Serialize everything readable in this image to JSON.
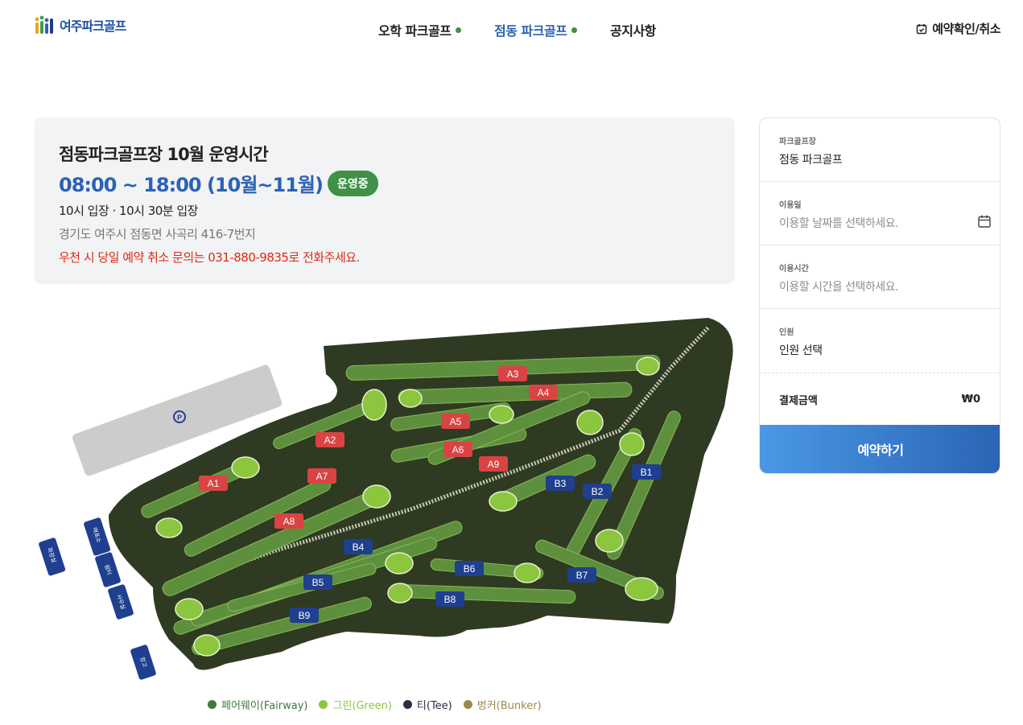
{
  "header": {
    "logo_text": "여주파크골프",
    "nav": [
      {
        "label": "오학 파크골프"
      },
      {
        "label": "점동 파크골프"
      },
      {
        "label": "공지사항"
      }
    ],
    "reserve_label": "예약확인/취소"
  },
  "info": {
    "title": "점동파크골프장 10월 운영시간",
    "hours": "08:00 ~ 18:00 (10월~11월)",
    "status_badge": "운영중",
    "entry": "10시 입장 · 10시 30분 입장",
    "address": "경기도 여주시 점동면 사곡리 416-7번지",
    "notice": "우천 시 당일 예약 취소 문의는 031-880-9835로 전화주세요."
  },
  "map": {
    "holes_a": [
      "A1",
      "A2",
      "A3",
      "A4",
      "A5",
      "A6",
      "A7",
      "A8",
      "A9"
    ],
    "holes_b": [
      "B1",
      "B2",
      "B3",
      "B4",
      "B5",
      "B6",
      "B7",
      "B8",
      "B9"
    ],
    "facilities": [
      "화장실",
      "매표소",
      "쉼터",
      "사무실",
      "창고"
    ],
    "parking_symbol": "P"
  },
  "legend": [
    {
      "label": "페어웨이(Fairway)",
      "color": "#3f7a3a"
    },
    {
      "label": "그린(Green)",
      "color": "#8cc63f"
    },
    {
      "label": "티(Tee)",
      "color": "#263040"
    },
    {
      "label": "벙커(Bunker)",
      "color": "#9a8a4f"
    }
  ],
  "booking": {
    "course_label": "파크골프장",
    "course_value": "점동 파크골프",
    "date_label": "이용일",
    "date_placeholder": "이용할 날짜를 선택하세요.",
    "time_label": "이용시간",
    "time_placeholder": "이용할 시간을 선택하세요.",
    "people_label": "인원",
    "people_value": "인원 선택",
    "pay_label": "결제금액",
    "pay_value": "₩0",
    "button_label": "예약하기"
  },
  "colors": {
    "accent": "#2b62b5",
    "status_green": "#3e9146",
    "notice_red": "#e02a12",
    "hole_a": "#d94343",
    "hole_b": "#1f3f8f",
    "ground": "#2f3a22"
  }
}
